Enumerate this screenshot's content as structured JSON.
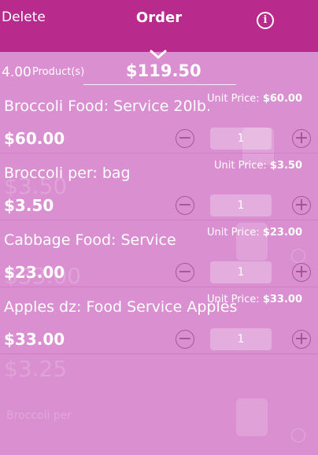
{
  "header": {
    "delete_label": "Delete",
    "title": "Order",
    "info_icon": "info-icon",
    "accent": "#b82a8c"
  },
  "summary": {
    "quantity": "4.00",
    "label": "Product(s)",
    "total": "$119.50"
  },
  "items": [
    {
      "name": "Broccoli Food:  Service 20lb.",
      "unit_label": "Unit Price: ",
      "unit_price": "$60.00",
      "price": "$60.00",
      "qty": "1"
    },
    {
      "name": "Broccoli per:  bag",
      "unit_label": "Unit Price: ",
      "unit_price": "$3.50",
      "price": "$3.50",
      "qty": "1"
    },
    {
      "name": "Cabbage Food:  Service",
      "unit_label": "Unit Price: ",
      "unit_price": "$23.00",
      "price": "$23.00",
      "qty": "1"
    },
    {
      "name": "Apples dz: Food Service Apples",
      "unit_label": "Unit Price: ",
      "unit_price": "$33.00",
      "price": "$33.00",
      "qty": "1"
    }
  ],
  "background_list": {
    "prices": [
      "$3.50",
      "$33.00",
      "$3.25"
    ],
    "labels": [
      "Broccoli per"
    ]
  },
  "colors": {
    "overlay": "#d98fd0",
    "header": "#b82a8c"
  }
}
